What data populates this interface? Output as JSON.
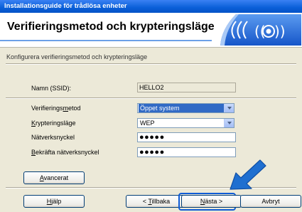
{
  "window": {
    "title": "Installationsguide för trådlösa enheter"
  },
  "header": {
    "title": "Verifieringsmetod och krypteringsläge"
  },
  "subtitle": "Konfigurera verifieringsmetod och krypteringsläge",
  "ssid": {
    "label": "Namn (SSID):",
    "value": "HELLO2"
  },
  "auth": {
    "label_pre": "Verifierings",
    "label_u": "m",
    "label_post": "etod",
    "selected": "Öppet system"
  },
  "encryption": {
    "label_u": "K",
    "label_post": "rypteringsläge",
    "selected": "WEP"
  },
  "network_key": {
    "label": "Nätverksnyckel",
    "value": "●●●●●"
  },
  "confirm_key": {
    "label_u": "B",
    "label_post": "ekräfta nätverksnyckel",
    "value": "●●●●●"
  },
  "buttons": {
    "advanced_u": "A",
    "advanced_post": "vancerat",
    "help_u": "H",
    "help_post": "jälp",
    "back_pre": "< ",
    "back_u": "T",
    "back_post": "illbaka",
    "next_u": "N",
    "next_post": "ästa >",
    "cancel": "Avbryt"
  },
  "colors": {
    "titlebar": "#0A5FD8",
    "dialog_bg": "#ECE9D8",
    "accent_blue": "#1F6FD0",
    "selection": "#316AC5"
  },
  "icons": {
    "logo": "wifi-waves-logo",
    "pointer": "blue-pointer-arrow"
  }
}
